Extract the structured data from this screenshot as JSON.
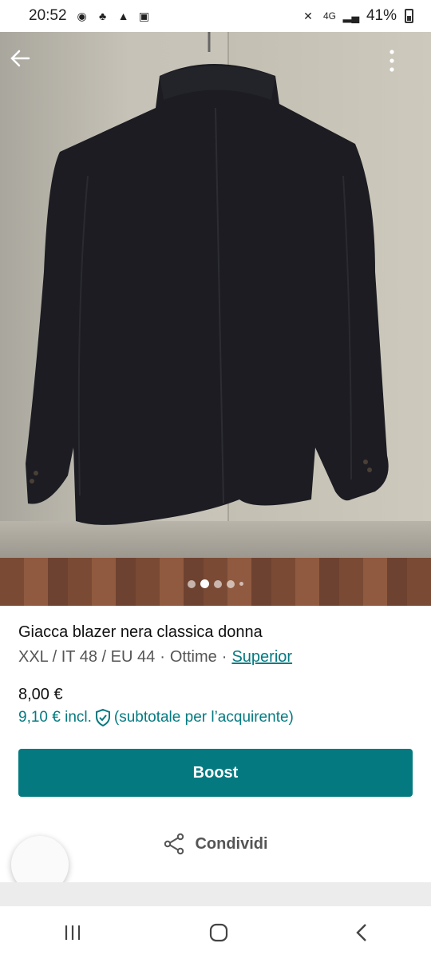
{
  "status_bar": {
    "time": "20:52",
    "network": "4G",
    "battery": "41%"
  },
  "listing": {
    "title": "Giacca blazer nera classica donna",
    "size": "XXL / IT 48 / EU 44",
    "separator": "·",
    "condition": "Ottime",
    "brand": "Superior",
    "price": "8,00 €",
    "price_incl": "9,10 € incl.",
    "price_note": "(subtotale per l’acquirente)",
    "photo_index": 2,
    "photo_count": 5
  },
  "actions": {
    "boost_label": "Boost",
    "share_label": "Condividi"
  },
  "colors": {
    "accent": "#047a80"
  },
  "icons": [
    "back-arrow-icon",
    "more-vert-icon",
    "shield-check-icon",
    "share-icon",
    "recents-icon",
    "home-icon",
    "back-icon"
  ]
}
